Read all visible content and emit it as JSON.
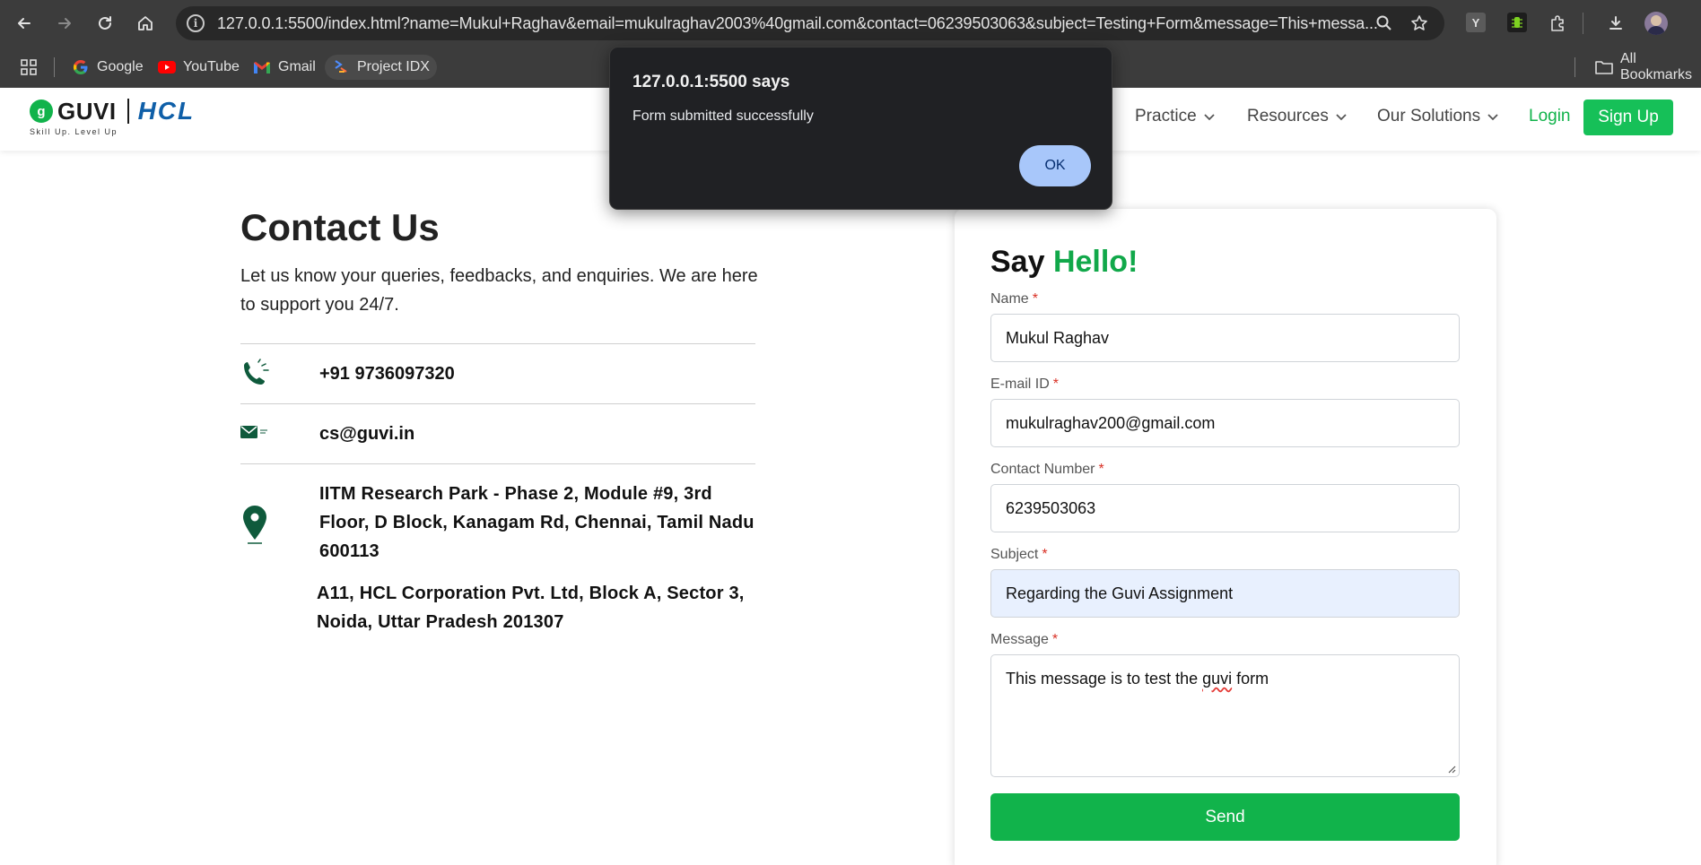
{
  "browser": {
    "url": "127.0.0.1:5500/index.html?name=Mukul+Raghav&email=mukulraghav2003%40gmail.com&contact=06239503063&subject=Testing+Form&message=This+messa...",
    "bookmarks": [
      {
        "label": "Google",
        "icon": "google-icon"
      },
      {
        "label": "YouTube",
        "icon": "youtube-icon"
      },
      {
        "label": "Gmail",
        "icon": "gmail-icon"
      },
      {
        "label": "Project IDX",
        "icon": "project-idx-icon"
      }
    ],
    "all_bookmarks": "All Bookmarks",
    "extension_y_label": "Y"
  },
  "header": {
    "logo_guvi": "GUVI",
    "logo_hcl": "HCL",
    "logo_tagline": "Skill Up. Level Up",
    "nav": [
      "Practice",
      "Resources",
      "Our Solutions"
    ],
    "login": "Login",
    "signup": "Sign Up"
  },
  "contact": {
    "title": "Contact Us",
    "description": "Let us know your queries, feedbacks, and enquiries. We are here to support you 24/7.",
    "phone": "+91 9736097320",
    "email": "cs@guvi.in",
    "address_1": "IITM Research Park - Phase 2, Module #9, 3rd Floor, D Block, Kanagam Rd, Chennai, Tamil Nadu 600113",
    "address_2": "A11, HCL Corporation Pvt. Ltd, Block A, Sector 3, Noida, Uttar Pradesh 201307"
  },
  "form": {
    "title_prefix": "Say",
    "title_accent": "Hello!",
    "name_label": "Name",
    "name_value": "Mukul Raghav",
    "email_label": "E-mail ID",
    "email_value": "mukulraghav200@gmail.com",
    "contact_label": "Contact Number",
    "contact_value": "6239503063",
    "subject_label": "Subject",
    "subject_value": "Regarding the Guvi Assignment",
    "message_label": "Message",
    "message_before": "This message is to test the ",
    "message_misspelled": "guvi",
    "message_after": " form",
    "required_mark": "*",
    "send": "Send"
  },
  "dialog": {
    "title": "127.0.0.1:5500 says",
    "message": "Form submitted successfully",
    "ok": "OK"
  },
  "colors": {
    "brand_green": "#11b34b",
    "hcl_blue": "#0f5fa8",
    "autofill_blue": "#e8f0fe",
    "dialog_bg": "#202124",
    "dialog_button": "#a8c7fa"
  }
}
